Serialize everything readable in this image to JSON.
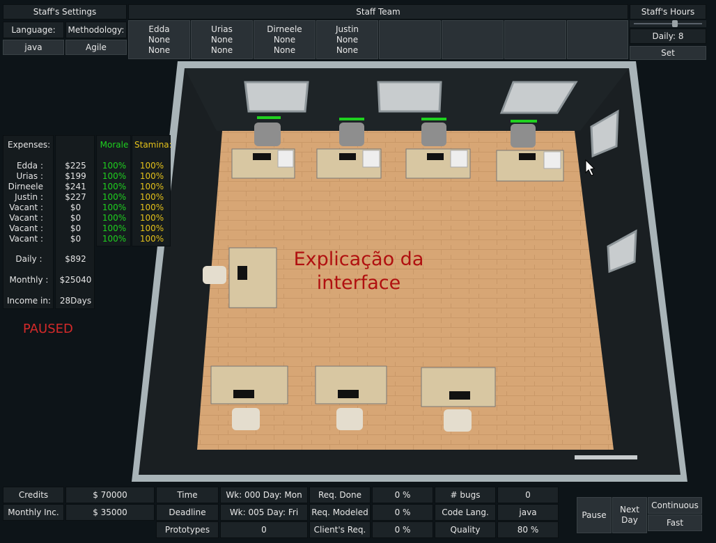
{
  "staff_settings": {
    "title": "Staff's Settings",
    "language_label": "Language:",
    "methodology_label": "Methodology:",
    "language_value": "java",
    "methodology_value": "Agile"
  },
  "staff_team": {
    "title": "Staff Team",
    "members": [
      {
        "name": "Edda",
        "line2": "None",
        "line3": "None"
      },
      {
        "name": "Urias",
        "line2": "None",
        "line3": "None"
      },
      {
        "name": "Dirneele",
        "line2": "None",
        "line3": "None"
      },
      {
        "name": "Justin",
        "line2": "None",
        "line3": "None"
      }
    ]
  },
  "staff_hours": {
    "title": "Staff's Hours",
    "daily": "Daily: 8",
    "slider_level": 0.6,
    "set": "Set"
  },
  "expenses": {
    "title": "Expenses:",
    "morale_header": "Morale",
    "stamina_header": "Stamina:",
    "rows": [
      {
        "name": "Edda :",
        "cost": "$225",
        "morale": "100%",
        "stamina": "100%"
      },
      {
        "name": "Urias :",
        "cost": "$199",
        "morale": "100%",
        "stamina": "100%"
      },
      {
        "name": "Dirneele :",
        "cost": "$241",
        "morale": "100%",
        "stamina": "100%"
      },
      {
        "name": "Justin :",
        "cost": "$227",
        "morale": "100%",
        "stamina": "100%"
      },
      {
        "name": "Vacant :",
        "cost": "$0",
        "morale": "100%",
        "stamina": "100%"
      },
      {
        "name": "Vacant :",
        "cost": "$0",
        "morale": "100%",
        "stamina": "100%"
      },
      {
        "name": "Vacant :",
        "cost": "$0",
        "morale": "100%",
        "stamina": "100%"
      },
      {
        "name": "Vacant :",
        "cost": "$0",
        "morale": "100%",
        "stamina": "100%"
      }
    ],
    "daily_label": "Daily :",
    "daily_value": "$892",
    "monthly_label": "Monthly :",
    "monthly_value": "$25040",
    "income_label": "Income in:",
    "income_value": "28Days"
  },
  "status": "PAUSED",
  "overlay_caption": "Explicação da interface",
  "bottom": {
    "credits_label": "Credits",
    "credits_value": "$ 70000",
    "monthly_inc_label": "Monthly Inc.",
    "monthly_inc_value": "$ 35000",
    "time_label": "Time",
    "time_value": "Wk: 000 Day: Mon",
    "deadline_label": "Deadline",
    "deadline_value": "Wk: 005 Day: Fri",
    "prototypes_label": "Prototypes",
    "prototypes_value": "0",
    "req_done_label": "Req. Done",
    "req_done_value": "0 %",
    "req_modeled_label": "Req. Modeled",
    "req_modeled_value": "0 %",
    "clients_req_label": "Client's Req.",
    "clients_req_value": "0 %",
    "bugs_label": "# bugs",
    "bugs_value": "0",
    "code_lang_label": "Code Lang.",
    "code_lang_value": "java",
    "quality_label": "Quality",
    "quality_value": "80 %"
  },
  "controls": {
    "pause": "Pause",
    "next_day_1": "Next",
    "next_day_2": "Day",
    "continuous": "Continuous",
    "fast": "Fast"
  },
  "colors": {
    "morale": "#1fd11f",
    "stamina": "#e5c21a",
    "paused": "#d42a2a",
    "caption": "#b01010",
    "floor": "#d9a877"
  }
}
